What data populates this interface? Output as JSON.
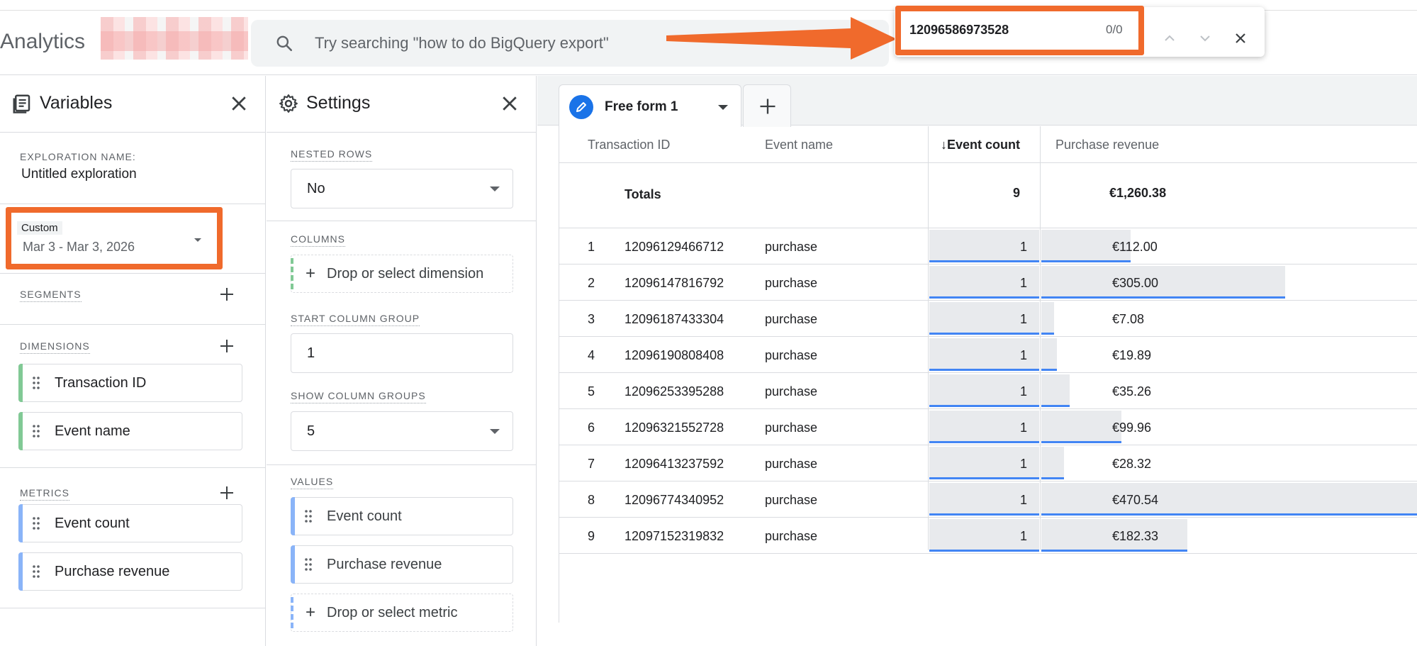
{
  "header": {
    "app_title": "Analytics",
    "search_placeholder": "Try searching \"how to do BigQuery export\"",
    "find_query": "12096586973528",
    "find_count": "0/0"
  },
  "variables": {
    "title": "Variables",
    "exploration_label": "EXPLORATION NAME:",
    "exploration_name": "Untitled exploration",
    "date_tag": "Custom",
    "date_range": "Mar 3 - Mar 3, 2026",
    "segments_label": "SEGMENTS",
    "dimensions_label": "DIMENSIONS",
    "dimensions": [
      "Transaction ID",
      "Event name"
    ],
    "metrics_label": "METRICS",
    "metrics": [
      "Event count",
      "Purchase revenue"
    ]
  },
  "settings": {
    "title": "Settings",
    "nested_rows_label": "NESTED ROWS",
    "nested_rows_value": "No",
    "columns_label": "COLUMNS",
    "columns_drop": "Drop or select dimension",
    "start_group_label": "START COLUMN GROUP",
    "start_group_value": "1",
    "show_groups_label": "SHOW COLUMN GROUPS",
    "show_groups_value": "5",
    "values_label": "VALUES",
    "values": [
      "Event count",
      "Purchase revenue"
    ],
    "values_drop": "Drop or select metric"
  },
  "tab": {
    "label": "Free form 1"
  },
  "table": {
    "headers": {
      "transaction_id": "Transaction ID",
      "event_name": "Event name",
      "event_count": "Event count",
      "purchase_revenue": "Purchase revenue"
    },
    "totals": {
      "label": "Totals",
      "event_count": "9",
      "revenue": "€1,260.38"
    },
    "rows": [
      {
        "n": "1",
        "id": "12096129466712",
        "event": "purchase",
        "count": "1",
        "revenue": "€112.00",
        "rev_value": 112.0
      },
      {
        "n": "2",
        "id": "12096147816792",
        "event": "purchase",
        "count": "1",
        "revenue": "€305.00",
        "rev_value": 305.0
      },
      {
        "n": "3",
        "id": "12096187433304",
        "event": "purchase",
        "count": "1",
        "revenue": "€7.08",
        "rev_value": 7.08
      },
      {
        "n": "4",
        "id": "12096190808408",
        "event": "purchase",
        "count": "1",
        "revenue": "€19.89",
        "rev_value": 19.89
      },
      {
        "n": "5",
        "id": "12096253395288",
        "event": "purchase",
        "count": "1",
        "revenue": "€35.26",
        "rev_value": 35.26
      },
      {
        "n": "6",
        "id": "12096321552728",
        "event": "purchase",
        "count": "1",
        "revenue": "€99.96",
        "rev_value": 99.96
      },
      {
        "n": "7",
        "id": "12096413237592",
        "event": "purchase",
        "count": "1",
        "revenue": "€28.32",
        "rev_value": 28.32
      },
      {
        "n": "8",
        "id": "12096774340952",
        "event": "purchase",
        "count": "1",
        "revenue": "€470.54",
        "rev_value": 470.54
      },
      {
        "n": "9",
        "id": "12097152319832",
        "event": "purchase",
        "count": "1",
        "revenue": "€182.33",
        "rev_value": 182.33
      }
    ]
  },
  "colors": {
    "annotation": "#f06a2c",
    "accent": "#1a73e8",
    "bar": "#4285f4",
    "dimension_chip": "#81c995",
    "metric_chip": "#8ab4f8"
  }
}
